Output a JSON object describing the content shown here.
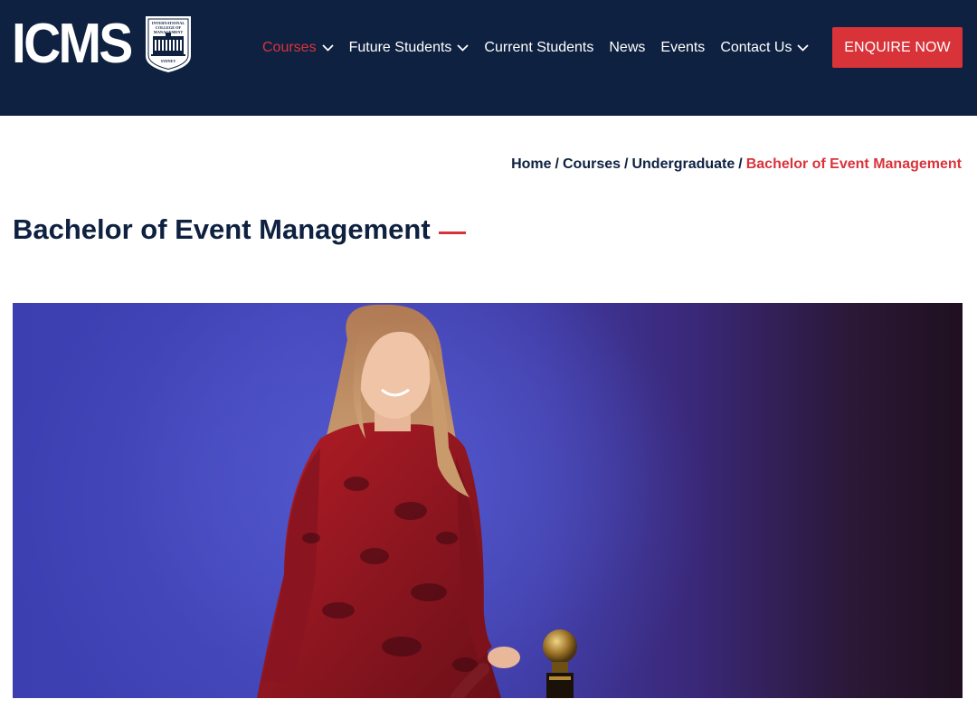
{
  "header": {
    "logo_text": "ICMS",
    "crest_lines": [
      "INTERNATIONAL",
      "COLLEGE OF",
      "MANAGEMENT",
      "SYDNEY"
    ],
    "nav": [
      {
        "label": "Courses",
        "has_dropdown": true,
        "active": true
      },
      {
        "label": "Future Students",
        "has_dropdown": true,
        "active": false
      },
      {
        "label": "Current Students",
        "has_dropdown": false,
        "active": false
      },
      {
        "label": "News",
        "has_dropdown": false,
        "active": false
      },
      {
        "label": "Events",
        "has_dropdown": false,
        "active": false
      },
      {
        "label": "Contact Us",
        "has_dropdown": true,
        "active": false
      }
    ],
    "cta_label": "ENQUIRE NOW"
  },
  "breadcrumb": {
    "items": [
      "Home",
      "Courses",
      "Undergraduate"
    ],
    "separator": "/",
    "current": "Bachelor of Event Management"
  },
  "page": {
    "title": "Bachelor of Event Management"
  },
  "colors": {
    "navy": "#0e2140",
    "accent_red": "#d9333a",
    "white": "#ffffff"
  },
  "icons": {
    "dropdown": "chevron-down-icon",
    "crest": "college-crest-icon"
  }
}
